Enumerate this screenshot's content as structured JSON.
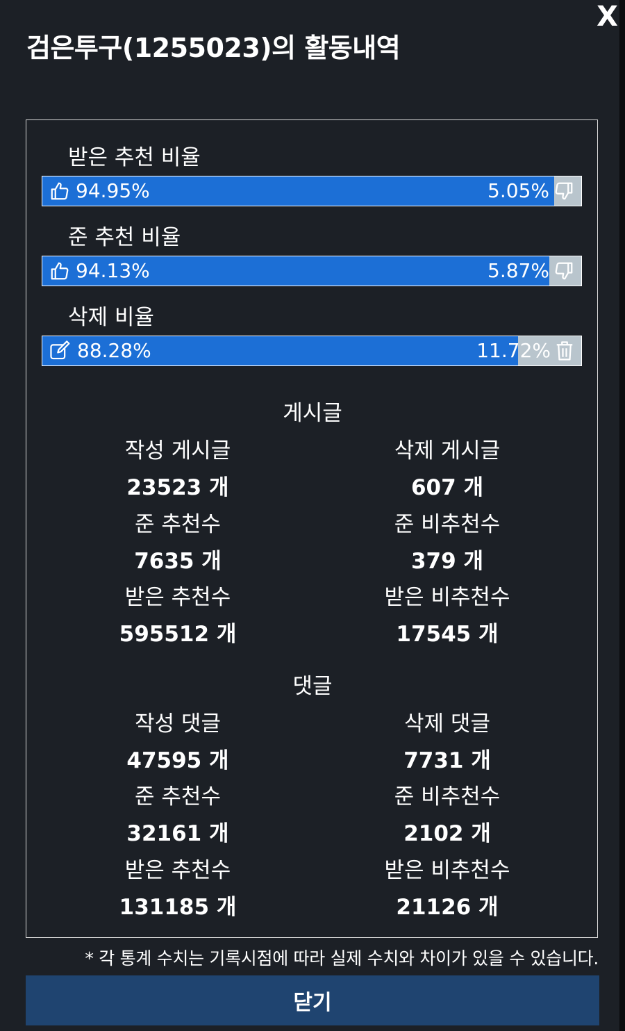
{
  "modal": {
    "title": "검은투구(1255023)의 활동내역",
    "close_glyph": "X"
  },
  "ratios": [
    {
      "label": "받은 추천 비율",
      "left_value": "94.95%",
      "right_value": "5.05%",
      "fraction": 0.9495,
      "left_icon": "thumbs-up-icon",
      "right_icon": "thumbs-down-icon"
    },
    {
      "label": "준 추천 비율",
      "left_value": "94.13%",
      "right_value": "5.87%",
      "fraction": 0.9413,
      "left_icon": "thumbs-up-icon",
      "right_icon": "thumbs-down-icon"
    },
    {
      "label": "삭제 비율",
      "left_value": "88.28%",
      "right_value": "11.72%",
      "fraction": 0.8828,
      "left_icon": "edit-icon",
      "right_icon": "trash-icon"
    }
  ],
  "posts": {
    "title": "게시글",
    "written_label": "작성 게시글",
    "written_value": "23523 개",
    "deleted_label": "삭제 게시글",
    "deleted_value": "607 개",
    "given_up_label": "준 추천수",
    "given_up_value": "7635 개",
    "given_down_label": "준 비추천수",
    "given_down_value": "379 개",
    "recv_up_label": "받은 추천수",
    "recv_up_value": "595512 개",
    "recv_down_label": "받은 비추천수",
    "recv_down_value": "17545 개"
  },
  "comments": {
    "title": "댓글",
    "written_label": "작성 댓글",
    "written_value": "47595 개",
    "deleted_label": "삭제 댓글",
    "deleted_value": "7731 개",
    "given_up_label": "준 추천수",
    "given_up_value": "32161 개",
    "given_down_label": "준 비추천수",
    "given_down_value": "2102 개",
    "recv_up_label": "받은 추천수",
    "recv_up_value": "131185 개",
    "recv_down_label": "받은 비추천수",
    "recv_down_value": "21126 개"
  },
  "notice": "* 각 통계 수치는 기록시점에 따라 실제 수치와 차이가 있을 수 있습니다.",
  "close_button_label": "닫기",
  "colors": {
    "background": "#1c2026",
    "bar_fill": "#1c6fd6",
    "bar_rest": "#b9c5cd",
    "button": "#1f4470"
  }
}
